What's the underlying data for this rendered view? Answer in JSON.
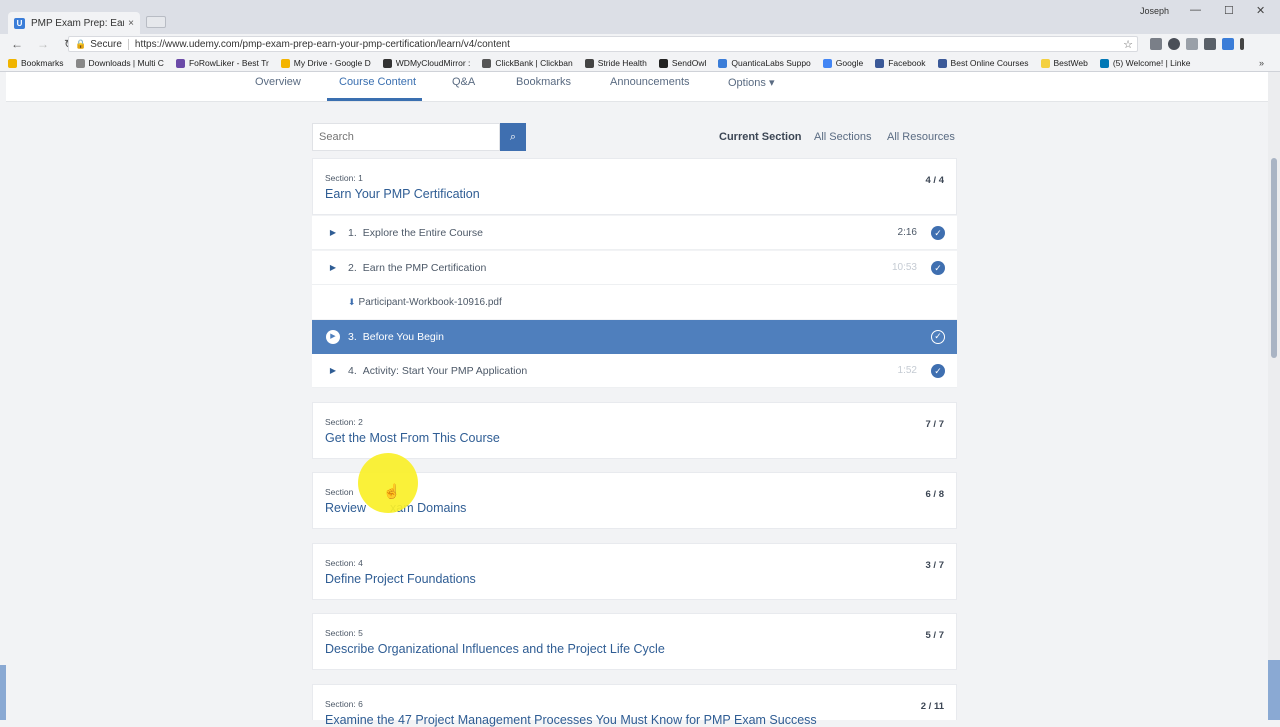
{
  "browser": {
    "tab_title": "PMP Exam Prep: Earn Yo",
    "tab_close": "×",
    "user": "Joseph",
    "secure_label": "Secure",
    "url": "https://www.udemy.com/pmp-exam-prep-earn-your-pmp-certification/learn/v4/content",
    "bookmarks": [
      {
        "label": "Bookmarks",
        "color": "#f0b400"
      },
      {
        "label": "Downloads | Multi C",
        "color": "#888888"
      },
      {
        "label": "FoRowLiker - Best Tr",
        "color": "#6b4aa8"
      },
      {
        "label": "My Drive - Google D",
        "color": "#f4b400"
      },
      {
        "label": "WDMyCloudMirror :",
        "color": "#333333"
      },
      {
        "label": "ClickBank | Clickban",
        "color": "#555555"
      },
      {
        "label": "Stride Health",
        "color": "#444444"
      },
      {
        "label": "SendOwl",
        "color": "#222222"
      },
      {
        "label": "QuanticaLabs Suppo",
        "color": "#3b7dd8"
      },
      {
        "label": "Google",
        "color": "#4285f4"
      },
      {
        "label": "Facebook",
        "color": "#3b5998"
      },
      {
        "label": "Best Online Courses",
        "color": "#3b5998"
      },
      {
        "label": "BestWeb",
        "color": "#f4d03f"
      },
      {
        "label": "(5) Welcome! | Linke",
        "color": "#0077b5"
      }
    ]
  },
  "subnav": {
    "tabs": [
      "Overview",
      "Course Content",
      "Q&A",
      "Bookmarks",
      "Announcements",
      "Options ▾"
    ]
  },
  "search": {
    "placeholder": "Search"
  },
  "filters": [
    "Current Section",
    "All Sections",
    "All Resources"
  ],
  "sections": [
    {
      "label": "Section: 1",
      "title": "Earn Your PMP Certification",
      "count": "4 / 4"
    },
    {
      "label": "Section: 2",
      "title": "Get the Most From This Course",
      "count": "7 / 7"
    },
    {
      "label": "Section: 3",
      "title": "Review Exam Domains",
      "count": "6 / 8"
    },
    {
      "label": "Section: 4",
      "title": "Define Project Foundations",
      "count": "3 / 7"
    },
    {
      "label": "Section: 5",
      "title": "Describe Organizational Influences and the Project Life Cycle",
      "count": "5 / 7"
    },
    {
      "label": "Section: 6",
      "title": "Examine the 47 Project Management Processes You Must Know for PMP Exam Success",
      "count": "2 / 11"
    }
  ],
  "section3_visible": {
    "label": "Section",
    "title_a": "Review",
    "title_b": "xam Domains"
  },
  "lectures": [
    {
      "num": "1.",
      "title": "Explore the Entire Course",
      "duration": "2:16",
      "faint": false
    },
    {
      "num": "2.",
      "title": "Earn the PMP Certification",
      "duration": "10:53",
      "faint": true
    },
    {
      "num": "3.",
      "title": "Before You Begin",
      "duration": "",
      "faint": false
    },
    {
      "num": "4.",
      "title": "Activity: Start Your PMP Application",
      "duration": "1:52",
      "faint": true
    }
  ],
  "resource": {
    "label": "Participant-Workbook-10916.pdf"
  }
}
